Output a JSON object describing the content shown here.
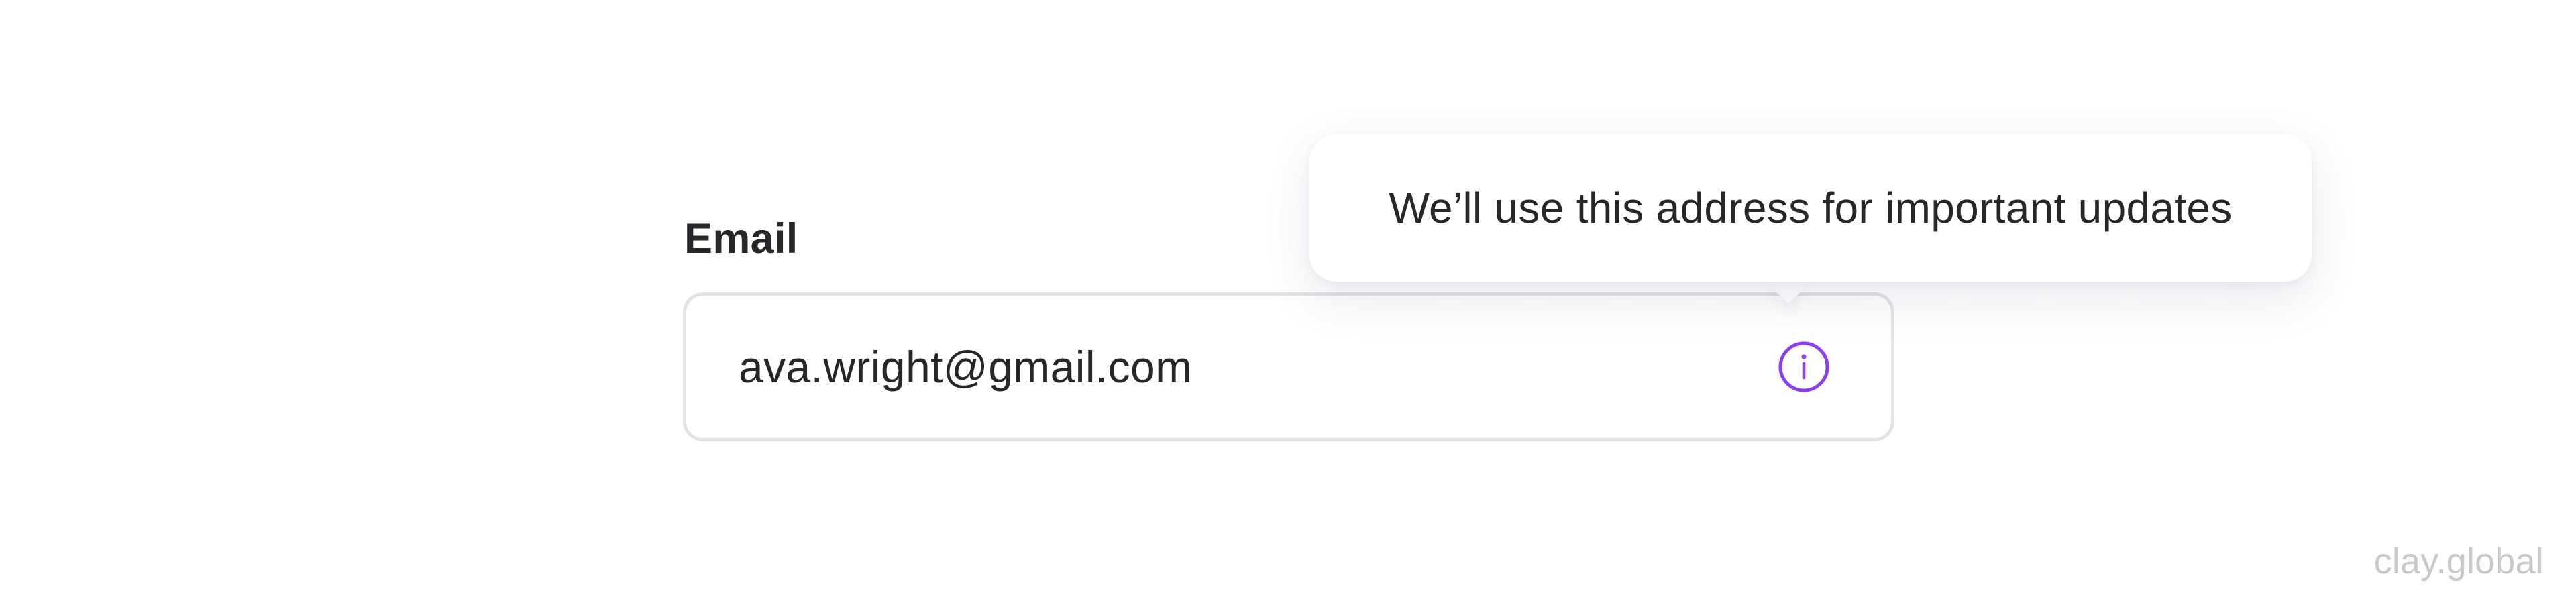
{
  "field": {
    "label": "Email",
    "value": "ava.wright@gmail.com",
    "info_icon": "info-circle-icon"
  },
  "tooltip": {
    "text": "We’ll use this address for important updates"
  },
  "watermark": {
    "text": "clay.global"
  },
  "colors": {
    "accent": "#8a3ff0",
    "text": "#26262b",
    "border": "#e3e3e7",
    "watermark": "#c9c9cd"
  }
}
